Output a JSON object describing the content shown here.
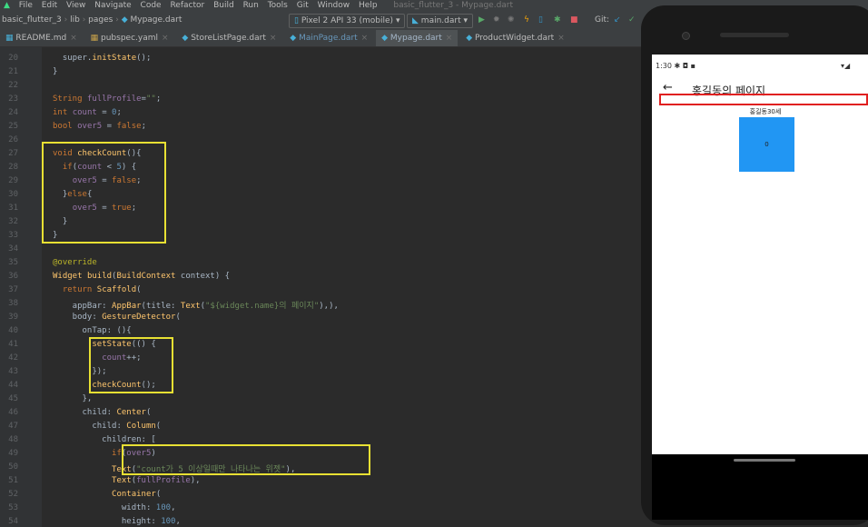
{
  "menu": [
    "File",
    "Edit",
    "View",
    "Navigate",
    "Code",
    "Refactor",
    "Build",
    "Run",
    "Tools",
    "Git",
    "Window",
    "Help"
  ],
  "window_title": "basic_flutter_3 - Mypage.dart",
  "breadcrumb": [
    "basic_flutter_3",
    "lib",
    "pages",
    "Mypage.dart"
  ],
  "toolbar": {
    "device": "Pixel 2 API 33 (mobile)",
    "run_config": "main.dart",
    "git_label": "Git:"
  },
  "tabs": [
    "README.md",
    "pubspec.yaml",
    "StoreListPage.dart",
    "MainPage.dart",
    "Mypage.dart",
    "ProductWidget.dart"
  ],
  "line_numbers": [
    "20",
    "21",
    "22",
    "23",
    "24",
    "25",
    "26",
    "27",
    "28",
    "29",
    "30",
    "31",
    "32",
    "33",
    "34",
    "35",
    "36",
    "37",
    "38",
    "39",
    "40",
    "41",
    "42",
    "43",
    "44",
    "45",
    "46",
    "47",
    "48",
    "49",
    "50",
    "51",
    "52",
    "53",
    "54"
  ],
  "code_lines": [
    "  super.initState();",
    "}",
    "",
    "String fullProfile=\"\";",
    "int count = 0;",
    "bool over5 = false;",
    "",
    "void checkCount(){",
    "  if(count < 5) {",
    "    over5 = false;",
    "  }else{",
    "    over5 = true;",
    "  }",
    "}",
    "",
    "@override",
    "Widget build(BuildContext context) {",
    "  return Scaffold(",
    "    appBar: AppBar(title: Text(\"${widget.name}의 페이지\"),),",
    "    body: GestureDetector(",
    "      onTap: (){",
    "        setState(() {",
    "          count++;",
    "        });",
    "        checkCount();",
    "      },",
    "      child: Center(",
    "        child: Column(",
    "          children: [",
    "            if(over5)",
    "            Text(\"count가 5 이상일때만 나타나는 위젯\"),",
    "            Text(fullProfile),",
    "            Container(",
    "              width: 100,",
    "              height: 100,"
  ],
  "phone": {
    "time": "1:30",
    "appbar_title": "홍길동의 페이지",
    "back": "←",
    "profile_text": "홍길동30세",
    "count_text": "0"
  }
}
